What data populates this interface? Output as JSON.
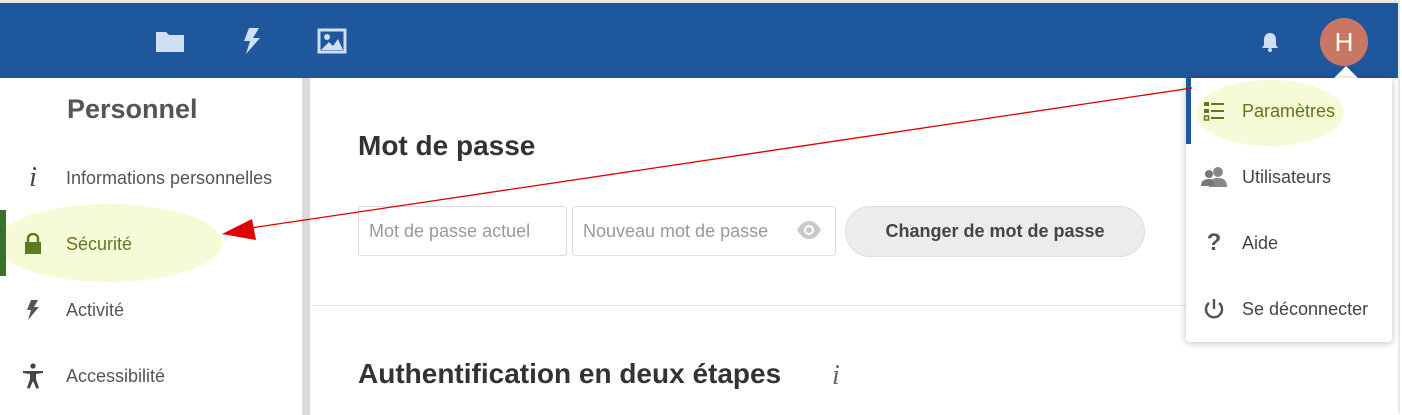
{
  "header": {
    "icons": [
      "folder-icon",
      "activity-bolt-icon",
      "image-icon"
    ],
    "bell_icon": "bell-icon",
    "avatar_initial": "H",
    "avatar_color": "#c77763",
    "bar_color": "#1f579c"
  },
  "sidebar": {
    "heading": "Personnel",
    "items": [
      {
        "label": "Informations personnelles",
        "icon": "info-icon"
      },
      {
        "label": "Sécurité",
        "icon": "lock-icon",
        "active": true
      },
      {
        "label": "Activité",
        "icon": "bolt-icon"
      },
      {
        "label": "Accessibilité",
        "icon": "accessibility-icon"
      }
    ]
  },
  "password_section": {
    "title": "Mot de passe",
    "current_placeholder": "Mot de passe actuel",
    "new_placeholder": "Nouveau mot de passe",
    "change_button": "Changer de mot de passe"
  },
  "twofa_section": {
    "title": "Authentification en deux étapes",
    "info_glyph": "i"
  },
  "user_menu": {
    "items": [
      {
        "label": "Paramètres",
        "icon": "settings-list-icon",
        "active": true
      },
      {
        "label": "Utilisateurs",
        "icon": "users-icon"
      },
      {
        "label": "Aide",
        "icon": "help-icon"
      },
      {
        "label": "Se déconnecter",
        "icon": "power-icon"
      }
    ]
  },
  "colors": {
    "highlight": "#f4fbd6",
    "active_text": "#5c7a1f",
    "annotation_arrow": "#e00000"
  }
}
